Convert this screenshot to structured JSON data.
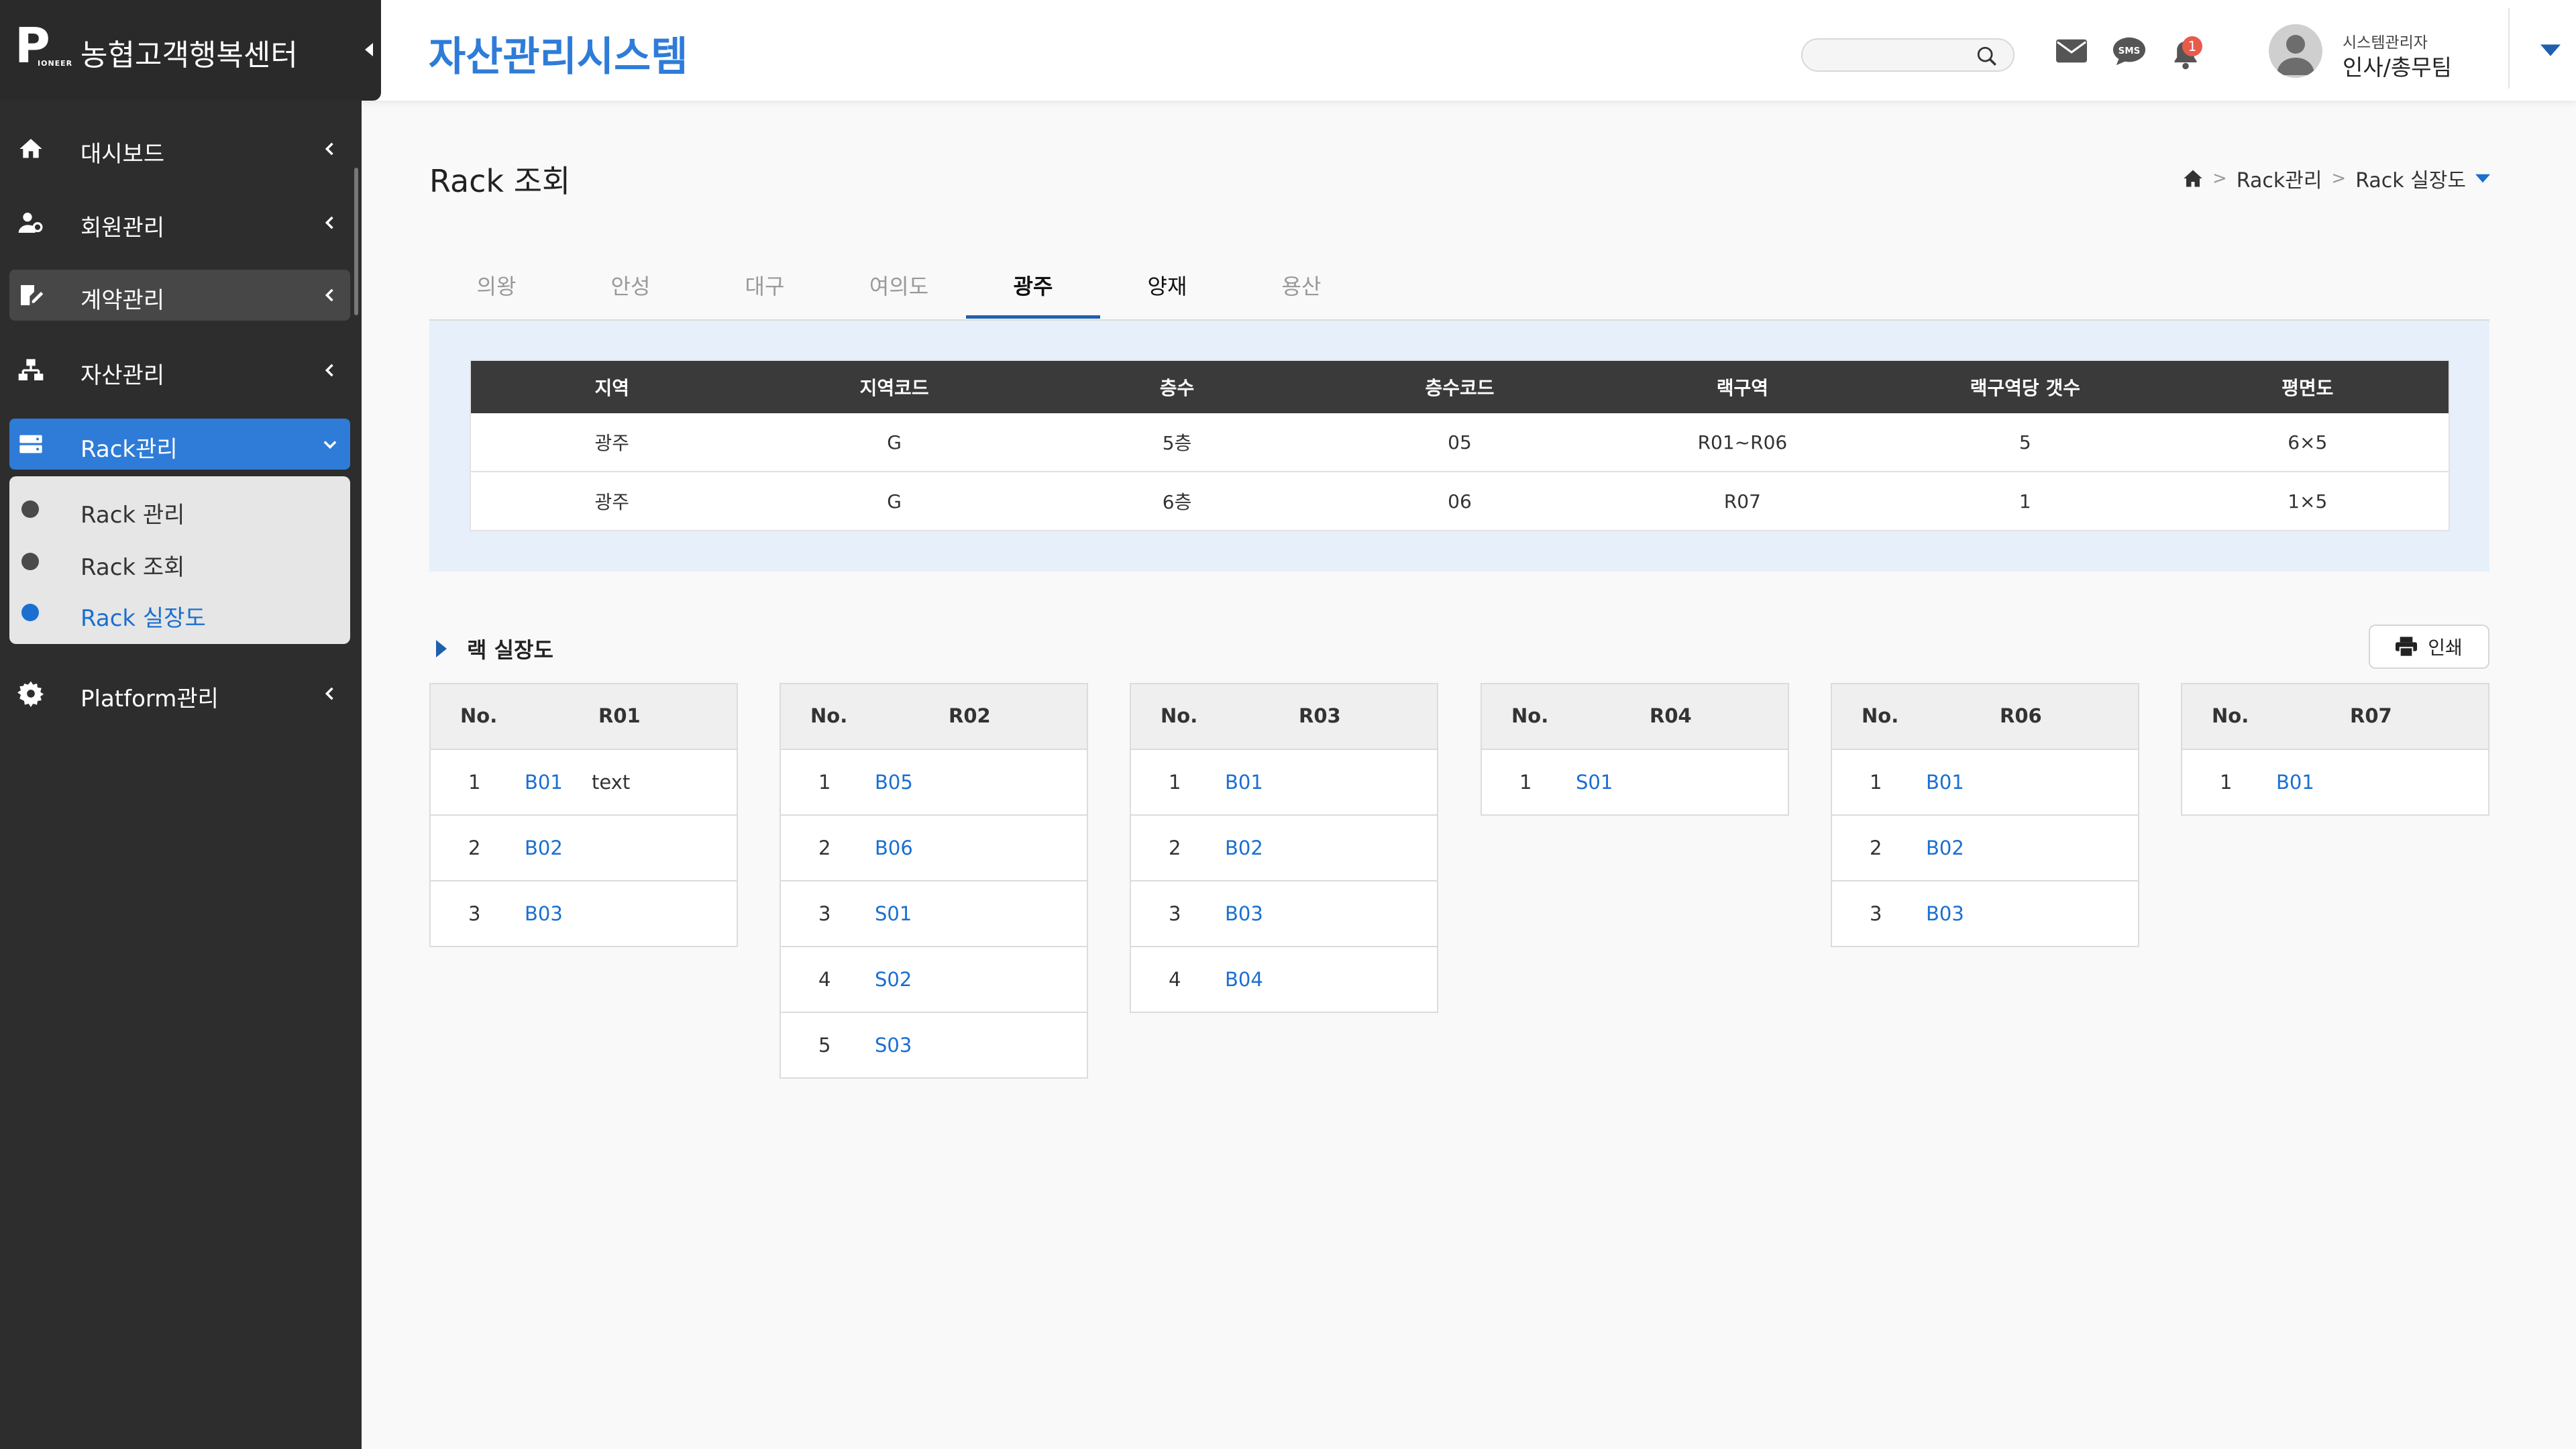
{
  "brand": {
    "logo_letter": "P",
    "logo_sub": "IONEER",
    "name": "농협고객행복센터"
  },
  "sidebar": {
    "items": [
      {
        "label": "대시보드"
      },
      {
        "label": "회원관리"
      },
      {
        "label": "계약관리"
      },
      {
        "label": "자산관리"
      },
      {
        "label": "Rack관리"
      },
      {
        "label": "Platform관리"
      }
    ],
    "submenu": [
      {
        "label": "Rack 관리"
      },
      {
        "label": "Rack 조회"
      },
      {
        "label": "Rack 실장도"
      }
    ]
  },
  "header": {
    "title": "자산관리시스템",
    "search_placeholder": "",
    "notification_count": "1",
    "user_role": "시스템관리자",
    "user_name": "인사/총무팀"
  },
  "page": {
    "title": "Rack 조회",
    "breadcrumb": [
      "Rack관리",
      "Rack 실장도"
    ]
  },
  "tabs": [
    "의왕",
    "안성",
    "대구",
    "여의도",
    "광주",
    "양재",
    "용산"
  ],
  "selected_tab": "광주",
  "info_table": {
    "headers": [
      "지역",
      "지역코드",
      "층수",
      "층수코드",
      "랙구역",
      "랙구역당 갯수",
      "평면도"
    ],
    "rows": [
      [
        "광주",
        "G",
        "5층",
        "05",
        "R01~R06",
        "5",
        "6×5"
      ],
      [
        "광주",
        "G",
        "6층",
        "06",
        "R07",
        "1",
        "1×5"
      ]
    ]
  },
  "section": {
    "title": "랙 실장도",
    "print_label": "인쇄"
  },
  "racks": [
    {
      "no_label": "No.",
      "name": "R01",
      "rows": [
        {
          "n": "1",
          "code": "B01",
          "extra": "text"
        },
        {
          "n": "2",
          "code": "B02",
          "extra": ""
        },
        {
          "n": "3",
          "code": "B03",
          "extra": ""
        }
      ]
    },
    {
      "no_label": "No.",
      "name": "R02",
      "rows": [
        {
          "n": "1",
          "code": "B05",
          "extra": ""
        },
        {
          "n": "2",
          "code": "B06",
          "extra": ""
        },
        {
          "n": "3",
          "code": "S01",
          "extra": ""
        },
        {
          "n": "4",
          "code": "S02",
          "extra": ""
        },
        {
          "n": "5",
          "code": "S03",
          "extra": ""
        }
      ]
    },
    {
      "no_label": "No.",
      "name": "R03",
      "rows": [
        {
          "n": "1",
          "code": "B01",
          "extra": ""
        },
        {
          "n": "2",
          "code": "B02",
          "extra": ""
        },
        {
          "n": "3",
          "code": "B03",
          "extra": ""
        },
        {
          "n": "4",
          "code": "B04",
          "extra": ""
        }
      ]
    },
    {
      "no_label": "No.",
      "name": "R04",
      "rows": [
        {
          "n": "1",
          "code": "S01",
          "extra": ""
        }
      ]
    },
    {
      "no_label": "No.",
      "name": "R06",
      "rows": [
        {
          "n": "1",
          "code": "B01",
          "extra": ""
        },
        {
          "n": "2",
          "code": "B02",
          "extra": ""
        },
        {
          "n": "3",
          "code": "B03",
          "extra": ""
        }
      ]
    },
    {
      "no_label": "No.",
      "name": "R07",
      "rows": [
        {
          "n": "1",
          "code": "B01",
          "extra": ""
        }
      ]
    }
  ],
  "colors": {
    "accent": "#2e7cd8",
    "link": "#1a6fd1",
    "sidebar_bg": "#2d2d2d",
    "panel_bg": "#e7f0fa",
    "table_head": "#3a3a3a",
    "badge": "#e85a4a"
  }
}
